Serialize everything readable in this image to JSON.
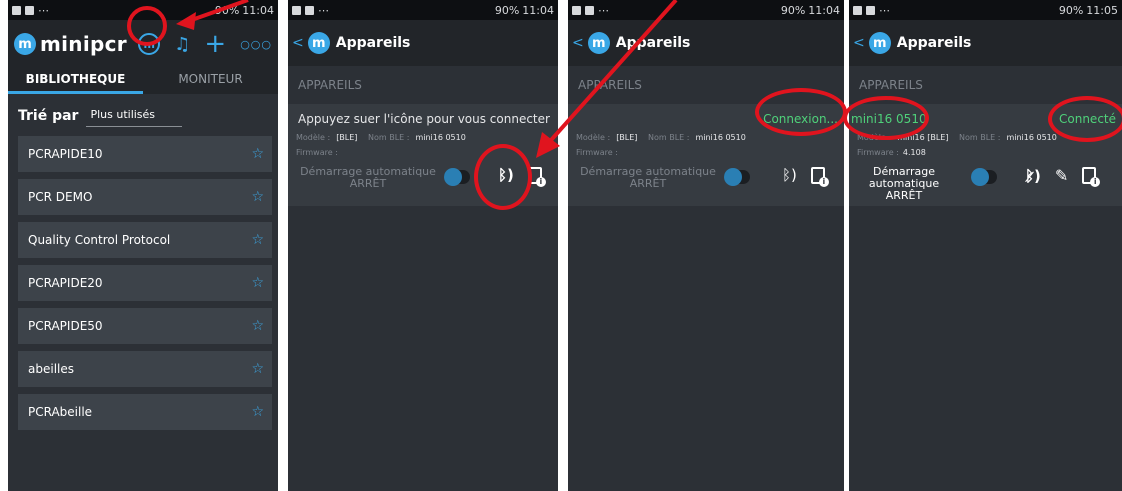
{
  "status_bar": {
    "left_icons": "⋯",
    "battery": "90%",
    "times": [
      "11:04",
      "11:04",
      "11:04",
      "11:05"
    ]
  },
  "library_screen": {
    "brand": "minipcr",
    "logo_letter": "m",
    "tabs": [
      {
        "label": "BIBLIOTHEQUE",
        "active": true
      },
      {
        "label": "MONITEUR",
        "active": false
      }
    ],
    "sort_label": "Trié par",
    "sort_value": "Plus utilisés",
    "items": [
      "PCRAPIDE10",
      "PCR DEMO",
      "Quality Control Protocol",
      "PCRAPIDE20",
      "PCRAPIDE50",
      "abeilles",
      "PCRAbeille"
    ]
  },
  "devices_screen": {
    "title": "Appareils",
    "section": "APPAREILS",
    "model_label": "Modèle :",
    "model_value": "[BLE]",
    "ble_label": "Nom BLE :",
    "ble_value": "mini16 0510",
    "firmware_label": "Firmware :",
    "auto_start": "Démarrage automatique ARRÊT"
  },
  "screens": [
    {
      "message": "Appuyez suer l'icône pour vous connecter"
    },
    {
      "status": "Connexion..."
    },
    {
      "device_name": "mini16 0510",
      "status": "Connecté",
      "firmware": "4.108",
      "model_value": "mini16 [BLE]",
      "ble_value": "mini16 0510"
    }
  ],
  "colors": {
    "accent": "#3aa7e6",
    "connected": "#4fd17a",
    "annotation": "#e0141e",
    "background": "#2c3036"
  }
}
